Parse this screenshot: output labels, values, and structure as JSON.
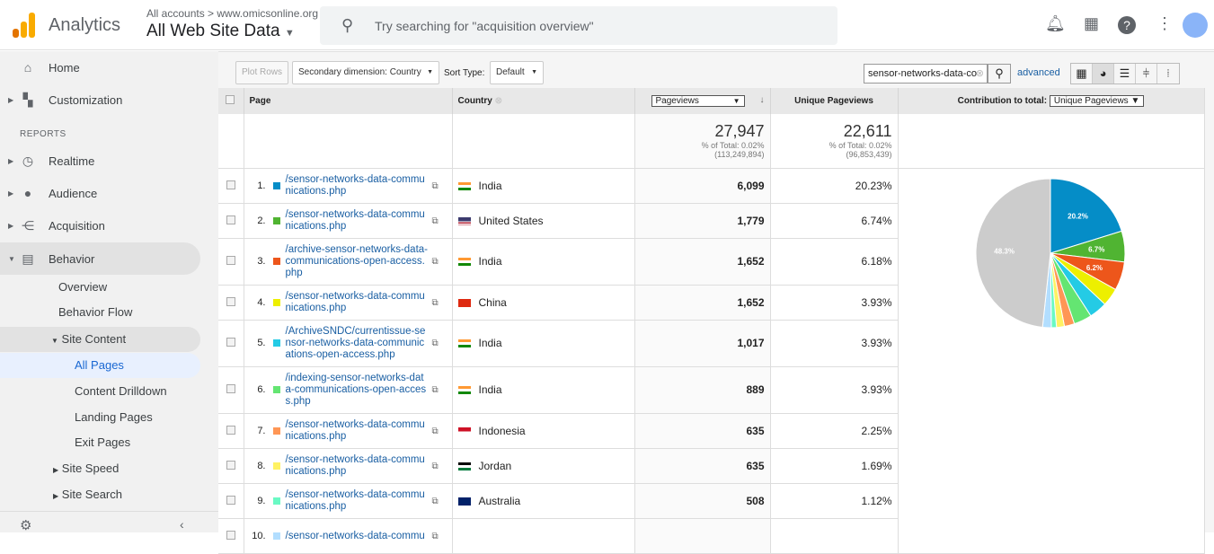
{
  "header": {
    "app_name": "Analytics",
    "account_path": "All accounts > www.omicsonline.org",
    "property": "All Web Site Data",
    "search_placeholder": "Try searching for \"acquisition overview\""
  },
  "sidebar": {
    "items": [
      {
        "label": "Home",
        "icon": "home-icon"
      },
      {
        "label": "Customization",
        "icon": "dashboard-icon"
      }
    ],
    "reports_label": "REPORTS",
    "reports": [
      {
        "label": "Realtime",
        "icon": "clock-icon"
      },
      {
        "label": "Audience",
        "icon": "person-icon"
      },
      {
        "label": "Acquisition",
        "icon": "acquisition-icon"
      },
      {
        "label": "Behavior",
        "icon": "behavior-icon"
      }
    ],
    "behavior_sub": [
      "Overview",
      "Behavior Flow",
      "Site Content",
      "All Pages",
      "Content Drilldown",
      "Landing Pages",
      "Exit Pages",
      "Site Speed",
      "Site Search"
    ]
  },
  "toolbar": {
    "plot_rows": "Plot Rows",
    "secondary_dimension": "Secondary dimension: Country",
    "sort_type_label": "Sort Type:",
    "sort_type": "Default",
    "filter_value": "sensor-networks-data-co",
    "advanced": "advanced"
  },
  "table": {
    "columns": {
      "page": "Page",
      "country": "Country",
      "pageviews": "Pageviews",
      "unique": "Unique Pageviews",
      "contribution": "Contribution to total:",
      "contribution_metric": "Unique Pageviews"
    },
    "totals": {
      "pageviews": "27,947",
      "pageviews_pct": "% of Total: 0.02%",
      "pageviews_total": "(113,249,894)",
      "unique": "22,611",
      "unique_pct": "% of Total: 0.02%",
      "unique_total": "(96,853,439)"
    },
    "rows": [
      {
        "n": "1.",
        "page": "/sensor-networks-data-communications.php",
        "country": "India",
        "pageviews": "6,099",
        "unique": "20.23%",
        "color": "#058dc7"
      },
      {
        "n": "2.",
        "page": "/sensor-networks-data-communications.php",
        "country": "United States",
        "pageviews": "1,779",
        "unique": "6.74%",
        "color": "#50b432"
      },
      {
        "n": "3.",
        "page": "/archive-sensor-networks-data-communications-open-access.php",
        "country": "India",
        "pageviews": "1,652",
        "unique": "6.18%",
        "color": "#ed561b"
      },
      {
        "n": "4.",
        "page": "/sensor-networks-data-communications.php",
        "country": "China",
        "pageviews": "1,652",
        "unique": "3.93%",
        "color": "#edef00"
      },
      {
        "n": "5.",
        "page": "/ArchiveSNDC/currentissue-sensor-networks-data-communications-open-access.php",
        "country": "India",
        "pageviews": "1,017",
        "unique": "3.93%",
        "color": "#24cbe5"
      },
      {
        "n": "6.",
        "page": "/indexing-sensor-networks-data-communications-open-access.php",
        "country": "India",
        "pageviews": "889",
        "unique": "3.93%",
        "color": "#64e572"
      },
      {
        "n": "7.",
        "page": "/sensor-networks-data-communications.php",
        "country": "Indonesia",
        "pageviews": "635",
        "unique": "2.25%",
        "color": "#ff9655"
      },
      {
        "n": "8.",
        "page": "/sensor-networks-data-communications.php",
        "country": "Jordan",
        "pageviews": "635",
        "unique": "1.69%",
        "color": "#fff263"
      },
      {
        "n": "9.",
        "page": "/sensor-networks-data-communications.php",
        "country": "Australia",
        "pageviews": "508",
        "unique": "1.12%",
        "color": "#6af9c4"
      },
      {
        "n": "10.",
        "page": "/sensor-networks-data-commu",
        "country": "",
        "pageviews": "",
        "unique": "",
        "color": "#b2deff"
      }
    ]
  },
  "chart_data": {
    "type": "pie",
    "values": [
      20.2,
      6.7,
      6.2,
      3.9,
      3.9,
      3.9,
      2.2,
      1.7,
      1.1,
      1.9,
      48.3
    ],
    "labels": [
      "20.2%",
      "6.7%",
      "6.2%",
      "",
      "",
      "",
      "",
      "",
      "",
      "",
      "48.3%"
    ],
    "colors": [
      "#058dc7",
      "#50b432",
      "#ed561b",
      "#edef00",
      "#24cbe5",
      "#64e572",
      "#ff9655",
      "#fff263",
      "#6af9c4",
      "#b2deff",
      "#cccccc"
    ]
  }
}
